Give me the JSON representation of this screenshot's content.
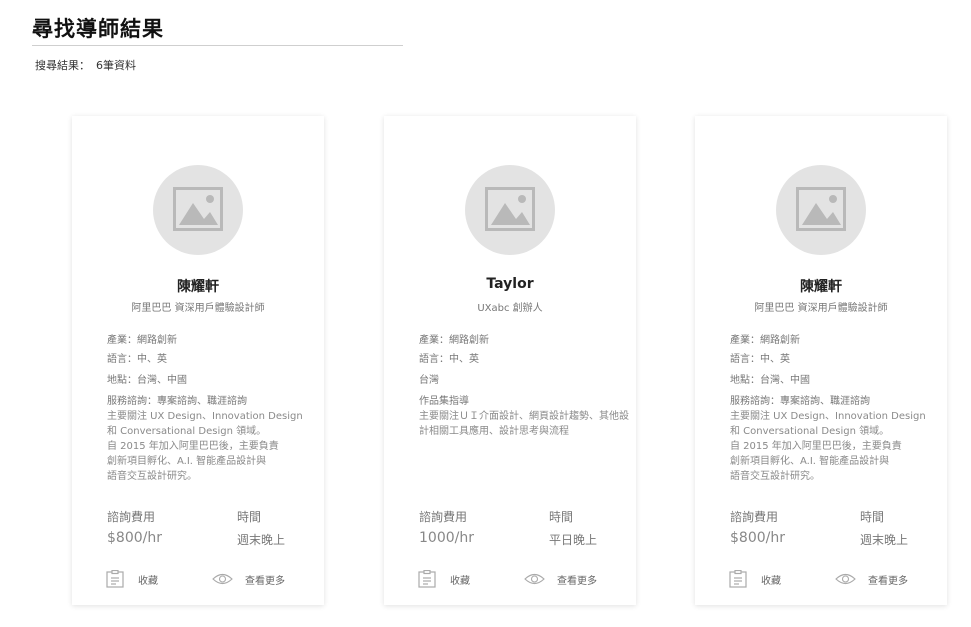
{
  "page": {
    "title": "尋找導師結果",
    "result_label": "搜尋結果：",
    "result_count": "6筆資料"
  },
  "cards": [
    {
      "name": "陳耀軒",
      "subtitle": "阿里巴巴 資深用戶體驗設計師",
      "info": [
        "產業：網路創新",
        "語言：中、英",
        "地點：台灣、中國",
        "服務諮詢：專案諮詢、職涯諮詢"
      ],
      "description": "主要關注 UX Design、Innovation Design\n和 Conversational Design 領域。\n自 2015 年加入阿里巴巴後，主要負責\n創新項目孵化、A.I. 智能產品設計與\n語音交互設計研究。",
      "fee_label": "諮詢費用",
      "fee": "$800/hr",
      "time_label": "時間",
      "time": "週末晚上",
      "save_label": "收藏",
      "more_label": "查看更多"
    },
    {
      "name": "Taylor",
      "subtitle": "UXabc 創辦人",
      "info": [
        "產業：網路創新",
        "語言：中、英",
        "台灣",
        "作品集指導"
      ],
      "description": "主要關注ＵＩ介面設計、網頁設計趨勢、其他設\n計相關工具應用、設計思考與流程",
      "fee_label": "諮詢費用",
      "fee": "1000/hr",
      "time_label": "時間",
      "time": "平日晚上",
      "save_label": "收藏",
      "more_label": "查看更多"
    },
    {
      "name": "陳耀軒",
      "subtitle": "阿里巴巴 資深用戶體驗設計師",
      "info": [
        "產業：網路創新",
        "語言：中、英",
        "地點：台灣、中國",
        "服務諮詢：專案諮詢、職涯諮詢"
      ],
      "description": "主要關注 UX Design、Innovation Design\n和 Conversational Design 領域。\n自 2015 年加入阿里巴巴後，主要負責\n創新項目孵化、A.I. 智能產品設計與\n語音交互設計研究。",
      "fee_label": "諮詢費用",
      "fee": "$800/hr",
      "time_label": "時間",
      "time": "週末晚上",
      "save_label": "收藏",
      "more_label": "查看更多"
    }
  ],
  "icons": {
    "avatar": "image-placeholder-icon",
    "save": "clipboard-icon",
    "more": "eye-icon"
  },
  "colors": {
    "avatar_bg": "#e3e3e3",
    "muted_text": "#777777"
  }
}
